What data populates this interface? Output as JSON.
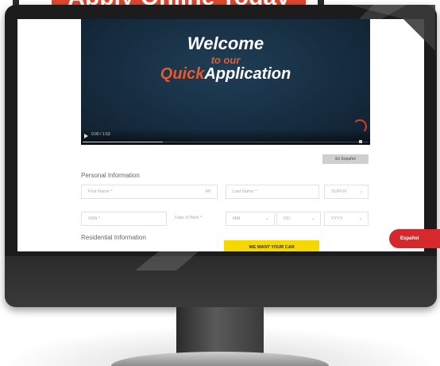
{
  "banner": {
    "text": "Apply Online Today"
  },
  "video": {
    "welcome": "Welcome",
    "to_our": "to our",
    "quick": "Quick",
    "application": "Application",
    "time": "0:00 / 1:53",
    "progress": 0.28
  },
  "buttons": {
    "translate": "En Español",
    "cta": "WE WANT YOUR CAR",
    "espanol": "Español"
  },
  "personal_section": {
    "title": "Personal Information",
    "first_name_placeholder": "First Name *",
    "middle_initial": "MI",
    "last_name_placeholder": "Last Name *",
    "suffix_placeholder": "SUFFIX",
    "ssn_placeholder": "SSN *",
    "dob_label": "Date of Birth *",
    "month_placeholder": "MM",
    "day_placeholder": "DD",
    "year_placeholder": "YYYY"
  },
  "residential_section": {
    "title": "Residential Information"
  },
  "colors": {
    "brand_orange": "#e85a2a",
    "video_bg": "#162c3f",
    "cta_yellow": "#f5d800",
    "espanol_red": "#d6292e"
  },
  "icons": [
    "play-icon",
    "chevron-down-icon",
    "logo-icon"
  ]
}
